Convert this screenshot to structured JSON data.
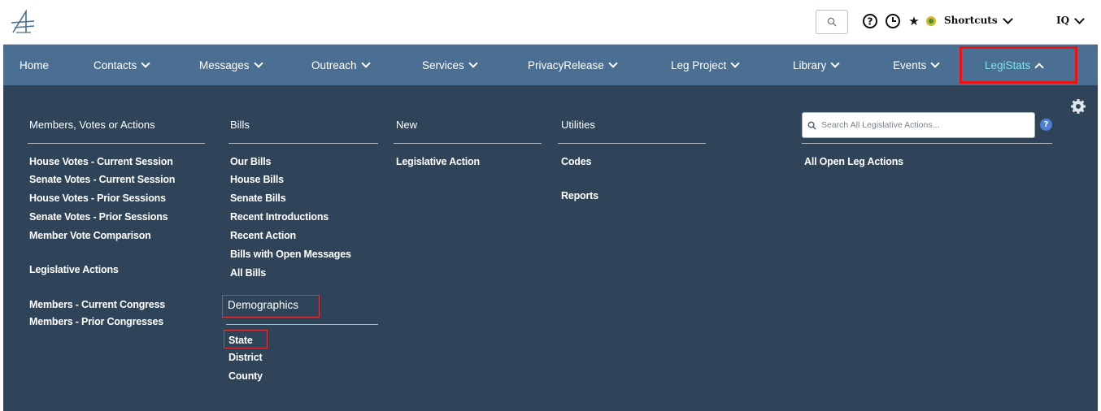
{
  "topbar": {
    "search_icon": "search-icon",
    "help_icon": "help-icon",
    "history_icon": "history-icon",
    "favorites_icon": "star-icon",
    "alert_icon": "alert-badge-icon",
    "shortcuts_label": "Shortcuts",
    "user_label": "IQ"
  },
  "nav": {
    "items": [
      "Home",
      "Contacts",
      "Messages",
      "Outreach",
      "Services",
      "PrivacyRelease",
      "Leg Project",
      "Library",
      "Events",
      "LegiStats"
    ],
    "active": "LegiStats"
  },
  "menu": {
    "col1": {
      "heading": "Members, Votes or Actions",
      "links": [
        "House Votes - Current Session",
        "Senate Votes - Current Session",
        "House Votes - Prior Sessions",
        "Senate Votes - Prior Sessions",
        "Member Vote Comparison"
      ],
      "legislative_actions": "Legislative Actions",
      "members": [
        "Members - Current Congress",
        "Members - Prior Congresses"
      ]
    },
    "col2": {
      "heading": "Bills",
      "links": [
        "Our Bills",
        "House Bills",
        "Senate Bills",
        "Recent Introductions",
        "Recent Action",
        "Bills with Open Messages",
        "All Bills"
      ],
      "demographics_heading": "Demographics",
      "demographics_links": [
        "State",
        "District",
        "County"
      ]
    },
    "col3": {
      "heading": "New",
      "links": [
        "Legislative Action"
      ]
    },
    "col4": {
      "heading": "Utilities",
      "links": [
        "Codes",
        "Reports"
      ]
    },
    "col5": {
      "search_placeholder": "Search All Legislative Actions...",
      "links": [
        "All Open Leg Actions"
      ]
    }
  },
  "colors": {
    "nav_bg": "#4a6f93",
    "menu_bg": "#2f4458",
    "active_text": "#7fe2e8",
    "highlight": "#ee1111"
  }
}
